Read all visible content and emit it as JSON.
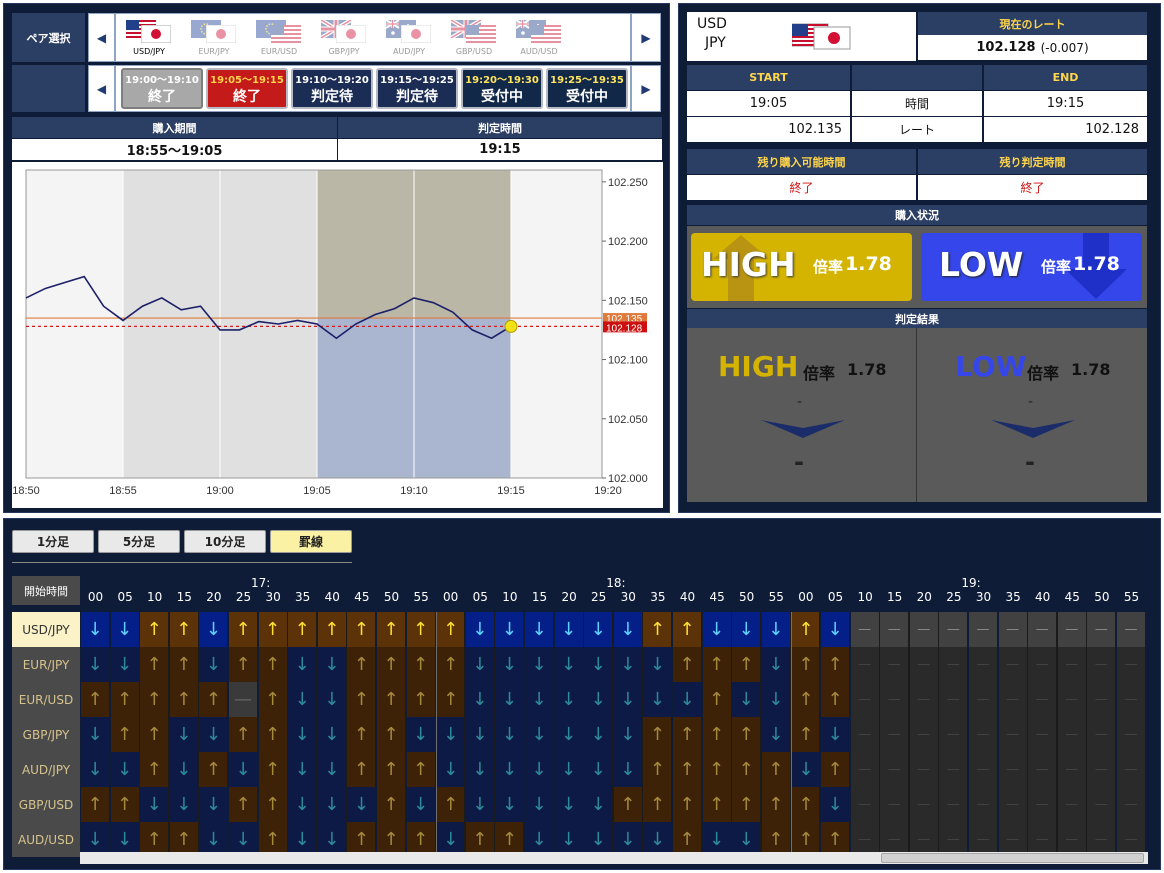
{
  "pair_selection": {
    "label": "ペア選択",
    "selected": "USD/JPY",
    "pairs": [
      {
        "name": "USD/JPY",
        "a": "us",
        "b": "jp"
      },
      {
        "name": "EUR/JPY",
        "a": "eu",
        "b": "jp"
      },
      {
        "name": "EUR/USD",
        "a": "eu",
        "b": "us"
      },
      {
        "name": "GBP/JPY",
        "a": "uk",
        "b": "jp"
      },
      {
        "name": "AUD/JPY",
        "a": "au",
        "b": "jp"
      },
      {
        "name": "GBP/USD",
        "a": "uk",
        "b": "us"
      },
      {
        "name": "AUD/USD",
        "a": "au",
        "b": "us"
      }
    ]
  },
  "time_slots": [
    {
      "time": "19:00〜19:10",
      "status": "終了",
      "bg": "#a8a8a8",
      "tc": "#ffffff"
    },
    {
      "time": "19:05〜19:15",
      "status": "終了",
      "bg": "#c41a1a",
      "tc": "#ffd54a"
    },
    {
      "time": "19:10〜19:20",
      "status": "判定待",
      "bg": "#1c2d55",
      "tc": "#ffffff"
    },
    {
      "time": "19:15〜19:25",
      "status": "判定待",
      "bg": "#1c2d55",
      "tc": "#ffffff"
    },
    {
      "time": "19:20〜19:30",
      "status": "受付中",
      "bg": "#122849",
      "tc": "#ffe55c"
    },
    {
      "time": "19:25〜19:35",
      "status": "受付中",
      "bg": "#122849",
      "tc": "#ffe55c"
    }
  ],
  "period": {
    "purchase_label": "購入期間",
    "purchase_value": "18:55〜19:05",
    "judge_label": "判定時間",
    "judge_value": "19:15"
  },
  "chart_data": {
    "type": "line",
    "x_ticks": [
      "18:50",
      "18:55",
      "19:00",
      "19:05",
      "19:10",
      "19:15",
      "19:20"
    ],
    "y_ticks": [
      "102.250",
      "102.200",
      "102.150",
      "102.100",
      "102.050",
      "102.000"
    ],
    "ylim": [
      102.0,
      102.26
    ],
    "start_rate_label": "102.135",
    "current_rate_label": "102.128",
    "start_rate": 102.135,
    "current_rate": 102.128,
    "x": [
      "18:50",
      "18:51",
      "18:52",
      "18:53",
      "18:54",
      "18:55",
      "18:56",
      "18:57",
      "18:58",
      "18:59",
      "19:00",
      "19:01",
      "19:02",
      "19:03",
      "19:04",
      "19:05",
      "19:06",
      "19:07",
      "19:08",
      "19:09",
      "19:10",
      "19:11",
      "19:12",
      "19:13",
      "19:14",
      "19:15"
    ],
    "y": [
      102.152,
      102.16,
      102.165,
      102.17,
      102.145,
      102.133,
      102.145,
      102.152,
      102.142,
      102.145,
      102.125,
      102.125,
      102.132,
      102.13,
      102.133,
      102.13,
      102.118,
      102.13,
      102.138,
      102.143,
      102.152,
      102.148,
      102.14,
      102.125,
      102.118,
      102.128
    ]
  },
  "right": {
    "base": "USD",
    "quote": "JPY",
    "current_rate_label": "現在のレート",
    "current_rate": "102.128",
    "change": "(-0.007)",
    "start_label": "START",
    "end_label": "END",
    "time_label": "時間",
    "rate_label": "レート",
    "start_time": "19:05",
    "end_time": "19:15",
    "start_rate": "102.135",
    "end_rate": "102.128",
    "remain_buy_label": "残り購入可能時間",
    "remain_judge_label": "残り判定時間",
    "remain_buy": "終了",
    "remain_judge": "終了",
    "purchase_status_label": "購入状況",
    "high_label": "HIGH",
    "low_label": "LOW",
    "payout_label": "倍率",
    "payout": "1.78",
    "result_label": "判定結果",
    "result_high_dash": "-",
    "result_high_value": "-",
    "result_low_dash": "-",
    "result_low_value": "-"
  },
  "bottom": {
    "tabs": [
      "1分足",
      "5分足",
      "10分足",
      "罫線"
    ],
    "active_tab": "罫線",
    "start_time_label": "開始時間",
    "hours": [
      "17:",
      "18:",
      "19:"
    ],
    "minutes": [
      "00",
      "05",
      "10",
      "15",
      "20",
      "25",
      "30",
      "35",
      "40",
      "45",
      "50",
      "55"
    ],
    "rows": [
      {
        "pair": "USD/JPY",
        "cells": "DDUUDUUUUUUUUDDDDDDUUDDDUD"
      },
      {
        "pair": "EUR/JPY",
        "cells": "DDUUDUUDDUUUUDDDDDDDUUUDUU"
      },
      {
        "pair": "EUR/USD",
        "cells": "UUUUU-UDDUUUUDDDDDDDDUDDUU"
      },
      {
        "pair": "GBP/JPY",
        "cells": "DUUDDUUDDUUDDDDDDDDUUUUDUD"
      },
      {
        "pair": "AUD/JPY",
        "cells": "DDUDUDUDDUUUDDDDDDDUUUUUDU"
      },
      {
        "pair": "GBP/USD",
        "cells": "UUDDDUUDDDUDUDDDDDUUUUUUUD"
      },
      {
        "pair": "AUD/USD",
        "cells": "DDUUDDUDDUUUDUUDDDDDUDDUUU"
      }
    ]
  },
  "colors": {
    "up_dark": "#3e2208",
    "down_dark": "#0d1a45",
    "up_bright": "#5c3208",
    "down_bright": "#042088",
    "empty": "#2a2a2a",
    "high_btn": "#d4b400",
    "low_btn": "#3547ea"
  }
}
